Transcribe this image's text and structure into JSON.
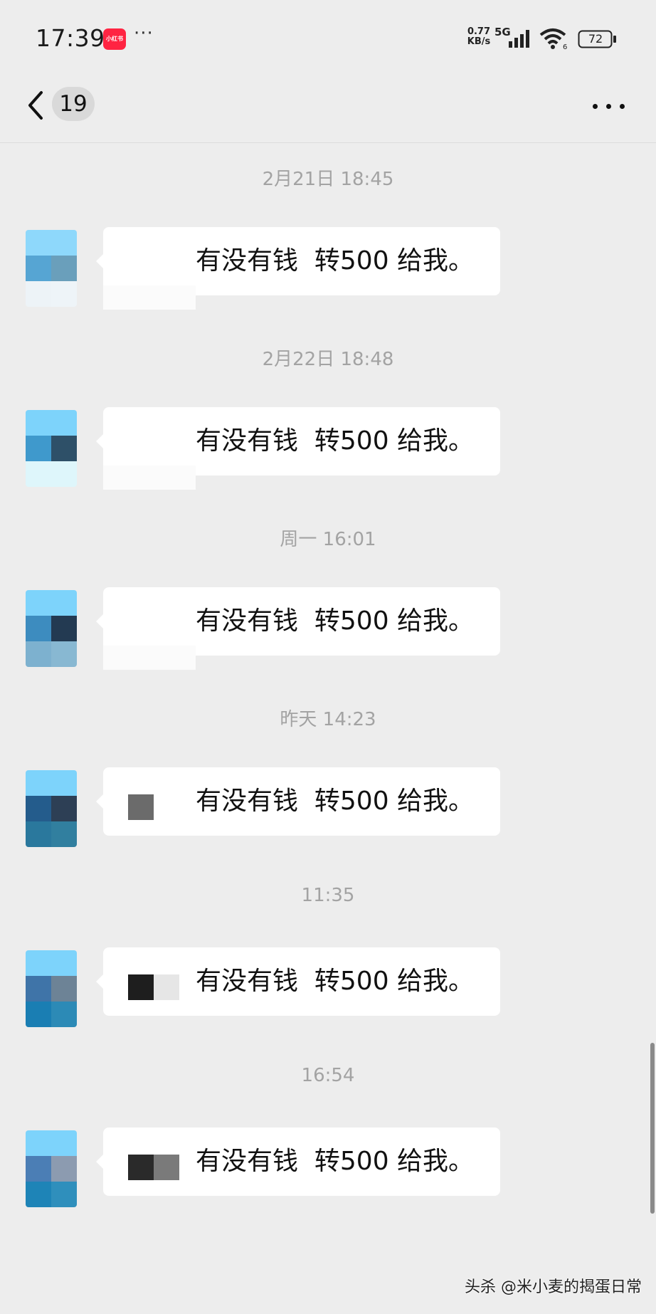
{
  "status_bar": {
    "time": "17:39",
    "app_badge": "小红书",
    "more_dots": "···",
    "net_speed": "0.77 KB/s",
    "net_type": "5G",
    "wifi_label": "6",
    "battery": "72",
    "icons": [
      "signal-icon",
      "wifi-icon",
      "battery-icon"
    ]
  },
  "header": {
    "back_icon": "chevron-left-icon",
    "unread_count": "19",
    "more_icon": "more-horizontal-icon"
  },
  "messages": [
    {
      "time": "2月21日 18:45",
      "text": "有没有钱  转500 给我。",
      "redact": []
    },
    {
      "time": "2月22日 18:48",
      "text": "有没有钱  转500 给我。",
      "redact": []
    },
    {
      "time": "周一 16:01",
      "text": "有没有钱  转500 给我。",
      "redact": []
    },
    {
      "time": "昨天 14:23",
      "text": "有没有钱  转500 给我。",
      "redact": [
        "#6b6b6b"
      ]
    },
    {
      "time": "11:35",
      "text": "有没有钱  转500 给我。",
      "redact": [
        "#1e1e1e",
        "#e6e6e6"
      ]
    },
    {
      "time": "16:54",
      "text": "有没有钱  转500 给我。",
      "redact": [
        "#2a2a2a",
        "#7a7a7a"
      ]
    }
  ],
  "avatar_colors": [
    [
      "#8ed8fb",
      "#8ed8fb",
      "#56a5d3",
      "#6a9fbb",
      "#edf3f7",
      "#eef4f8"
    ],
    [
      "#7dd3fb",
      "#7dd3fb",
      "#3f99cc",
      "#2e5068",
      "#def6fb",
      "#def6fb"
    ],
    [
      "#7dd3fb",
      "#7dd3fb",
      "#3d8cbf",
      "#233a52",
      "#7db1cf",
      "#88b8d2"
    ],
    [
      "#7dd3fb",
      "#7dd3fb",
      "#245c8c",
      "#2d3f55",
      "#2a789d",
      "#317f9f"
    ],
    [
      "#7dd3fb",
      "#7dd3fb",
      "#3f74a8",
      "#6d8396",
      "#1a7eb3",
      "#2c8ab6"
    ],
    [
      "#7dd3fb",
      "#7dd3fb",
      "#4b7eb5",
      "#8c9bb0",
      "#1e84b7",
      "#2f8fbc"
    ]
  ],
  "watermark": "头杀 @米小麦的揭蛋日常"
}
